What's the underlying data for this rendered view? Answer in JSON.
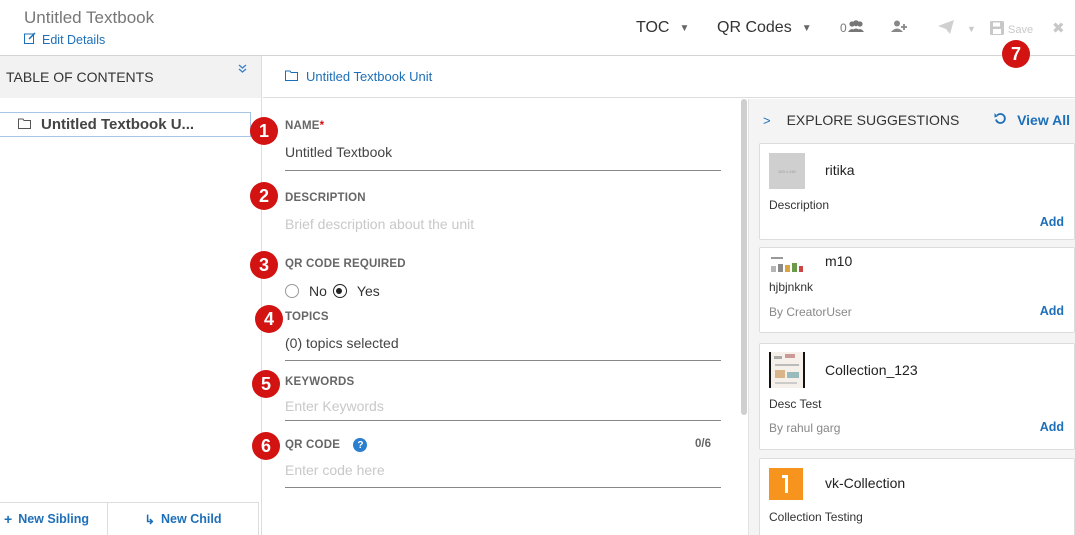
{
  "header": {
    "title": "Untitled Textbook",
    "edit_details": "Edit Details",
    "toc_menu": "TOC",
    "qr_menu": "QR Codes",
    "collab_count": "0",
    "save_label": "Save"
  },
  "toc": {
    "heading": "TABLE OF CONTENTS",
    "items": [
      {
        "label": "Untitled Textbook U..."
      }
    ],
    "new_sibling": "New Sibling",
    "new_child": "New Child"
  },
  "breadcrumb": {
    "label": "Untitled Textbook Unit"
  },
  "form": {
    "name_label": "NAME",
    "name_required": "*",
    "name_value": "Untitled Textbook",
    "description_label": "DESCRIPTION",
    "description_placeholder": "Brief description about the unit",
    "qr_required_label": "QR CODE REQUIRED",
    "qr_no": "No",
    "qr_yes": "Yes",
    "qr_selected": "Yes",
    "topics_label": "TOPICS",
    "topics_value": "(0) topics selected",
    "keywords_label": "KEYWORDS",
    "keywords_placeholder": "Enter Keywords",
    "qr_code_label": "QR CODE",
    "qr_code_placeholder": "Enter code here",
    "qr_code_counter": "0/6"
  },
  "badges": [
    "1",
    "2",
    "3",
    "4",
    "5",
    "6",
    "7"
  ],
  "suggestions": {
    "heading": "EXPLORE SUGGESTIONS",
    "view_all": "View All",
    "cards": [
      {
        "title": "ritika",
        "desc": "Description",
        "by": "",
        "add": "Add",
        "thumb_text": "320 x 240"
      },
      {
        "title": "m10",
        "desc": "hjbjnknk",
        "by": "By CreatorUser",
        "add": "Add"
      },
      {
        "title": "Collection_123",
        "desc": "Desc Test",
        "by": "By rahul garg",
        "add": "Add"
      },
      {
        "title": "vk-Collection",
        "desc": "Collection Testing",
        "by": "",
        "add": "Add"
      }
    ]
  },
  "colors": {
    "accent": "#1d6fb8",
    "badge": "#d31212",
    "thumb_orange": "#f7941d"
  }
}
